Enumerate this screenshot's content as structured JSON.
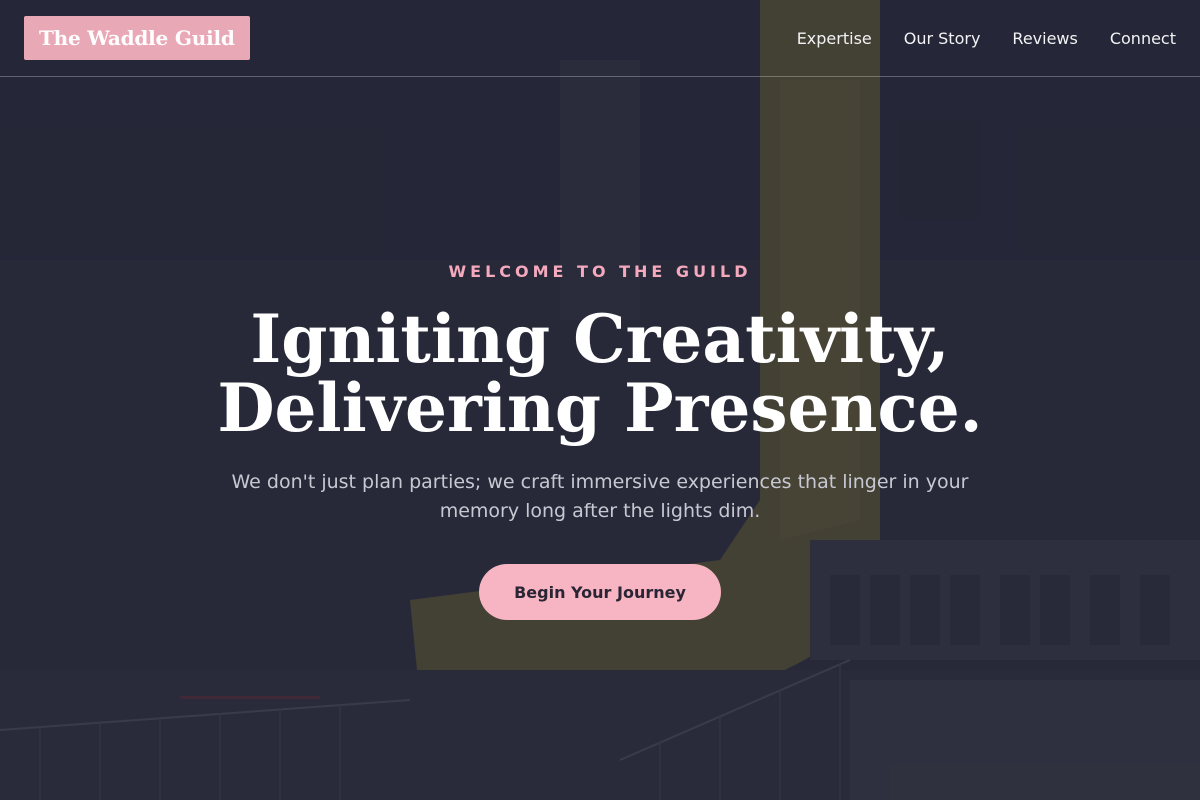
{
  "header": {
    "logo_text": "The Waddle Guild",
    "nav": [
      {
        "label": "Expertise"
      },
      {
        "label": "Our Story"
      },
      {
        "label": "Reviews"
      },
      {
        "label": "Connect"
      }
    ]
  },
  "hero": {
    "eyebrow": "WELCOME TO THE GUILD",
    "headline_line1": "Igniting Creativity,",
    "headline_line2": "Delivering Presence.",
    "subtext": "We don't just plan parties; we craft immersive experiences that linger in your memory long after the lights dim.",
    "cta_label": "Begin Your Journey"
  },
  "colors": {
    "accent_pink": "#f7b4c2",
    "logo_bg": "#e9a8b6",
    "overlay": "#222434"
  }
}
